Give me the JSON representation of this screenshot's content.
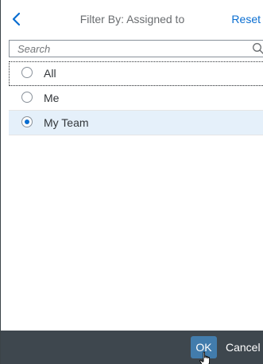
{
  "header": {
    "back_icon": "chevron-left-icon",
    "title": "Filter By: Assigned to",
    "reset_label": "Reset"
  },
  "search": {
    "value": "",
    "placeholder": "Search",
    "icon": "search-icon"
  },
  "options": [
    {
      "label": "All",
      "selected": false,
      "focused": true
    },
    {
      "label": "Me",
      "selected": false,
      "focused": false
    },
    {
      "label": "My Team",
      "selected": true,
      "focused": false
    }
  ],
  "footer": {
    "ok_label": "OK",
    "cancel_label": "Cancel"
  },
  "colors": {
    "accent": "#0a6ed1",
    "ok_button": "#427cac",
    "footer_bg": "#3e474e",
    "selected_row": "#e5f0fa",
    "title_text": "#6a6d70"
  }
}
